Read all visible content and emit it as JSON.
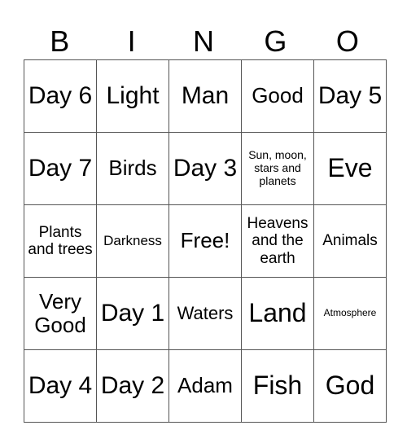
{
  "header": [
    "B",
    "I",
    "N",
    "G",
    "O"
  ],
  "grid": [
    [
      "Day 6",
      "Light",
      "Man",
      "Good",
      "Day 5"
    ],
    [
      "Day 7",
      "Birds",
      "Day 3",
      "Sun, moon, stars and planets",
      "Eve"
    ],
    [
      "Plants and trees",
      "Darkness",
      "Free!",
      "Heavens and the earth",
      "Animals"
    ],
    [
      "Very Good",
      "Day 1",
      "Waters",
      "Land",
      "Atmosphere"
    ],
    [
      "Day 4",
      "Day 2",
      "Adam",
      "Fish",
      "God"
    ]
  ]
}
